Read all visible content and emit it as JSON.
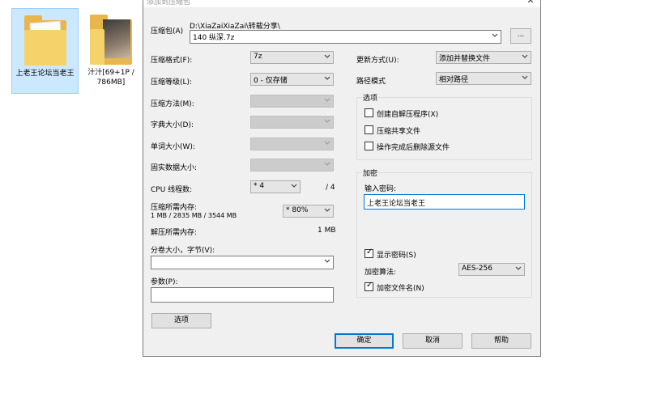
{
  "desktop": {
    "items": [
      {
        "label": "上老王论坛当老王"
      },
      {
        "label": "汁汁[69+1P / 786MB]"
      }
    ]
  },
  "dialog": {
    "title": "添加到压缩包",
    "close_glyph": "✕",
    "archive": {
      "label": "压缩包(A)",
      "path": "D:\\XiaZaiXiaZai\\转载分享\\",
      "value": "140 纵深.7z",
      "browse_label": "..."
    },
    "left": {
      "format_label": "压缩格式(F):",
      "format_value": "7z",
      "level_label": "压缩等级(L):",
      "level_value": "0 - 仅存储",
      "method_label": "压缩方法(M):",
      "dict_label": "字典大小(D):",
      "word_label": "单词大小(W):",
      "solid_label": "固实数据大小:",
      "cpu_label": "CPU 线程数:",
      "cpu_value": "* 4",
      "cpu_total": "/ 4",
      "mem_comp_label": "压缩所需内存:",
      "mem_comp_detail": "1 MB / 2835 MB / 3544 MB",
      "mem_comp_value": "* 80%",
      "mem_decomp_label": "解压所需内存:",
      "mem_decomp_value": "1 MB",
      "split_label": "分卷大小，字节(V):",
      "params_label": "参数(P):",
      "options_button": "选项"
    },
    "right": {
      "update_label": "更新方式(U):",
      "update_value": "添加并替换文件",
      "path_label": "路径模式",
      "path_value": "相对路径",
      "options_group": "选项",
      "opt_sfx": "创建自解压程序(X)",
      "opt_shared": "压缩共享文件",
      "opt_delete": "操作完成后删除源文件",
      "encrypt_group": "加密",
      "password_label": "输入密码:",
      "password_value": "上老王论坛当老王",
      "show_password": "显示密码(S)",
      "enc_method_label": "加密算法:",
      "enc_method_value": "AES-256",
      "encrypt_names": "加密文件名(N)"
    },
    "buttons": {
      "ok": "确定",
      "cancel": "取消",
      "help": "帮助"
    }
  }
}
